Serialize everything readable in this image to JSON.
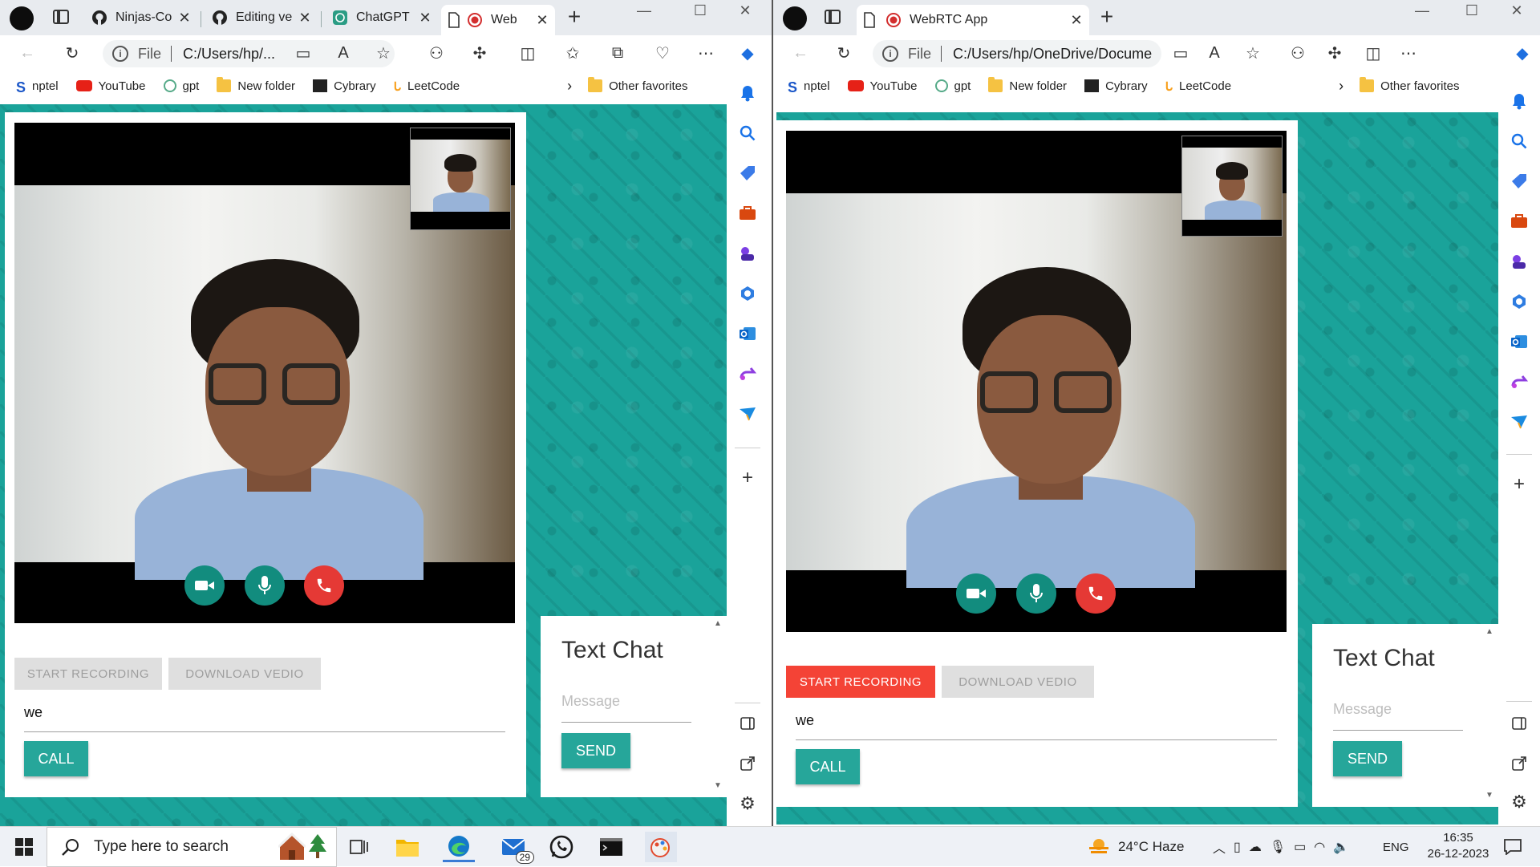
{
  "left_window": {
    "tabs": [
      {
        "label": "Ninjas-Co",
        "icon": "github-icon"
      },
      {
        "label": "Editing ve",
        "icon": "github-icon"
      },
      {
        "label": "ChatGPT",
        "icon": "chatgpt-icon"
      },
      {
        "label": "Web",
        "icon": "record-icon",
        "active": true
      }
    ],
    "address": {
      "prefix": "File",
      "url": "C:/Users/hp/..."
    },
    "favorites": [
      "nptel",
      "YouTube",
      "gpt",
      "New folder",
      "Cybrary",
      "LeetCode"
    ],
    "other_favorites": "Other favorites"
  },
  "right_window": {
    "tabs": [
      {
        "label": "WebRTC App",
        "icon": "record-icon",
        "active": true
      }
    ],
    "address": {
      "prefix": "File",
      "url": "C:/Users/hp/OneDrive/Documents..."
    },
    "favorites": [
      "nptel",
      "YouTube",
      "gpt",
      "New folder",
      "Cybrary",
      "LeetCode"
    ],
    "other_favorites": "Other favorites"
  },
  "app_left": {
    "start_recording": "START RECORDING",
    "download": "DOWNLOAD VEDIO",
    "message_value": "we",
    "call": "CALL",
    "chat_title": "Text Chat",
    "chat_placeholder": "Message",
    "send": "SEND"
  },
  "app_right": {
    "start_recording": "START RECORDING",
    "download": "DOWNLOAD VEDIO",
    "message_value": "we",
    "call": "CALL",
    "chat_title": "Text Chat",
    "chat_placeholder": "Message",
    "send": "SEND"
  },
  "colors": {
    "teal_bg": "#1aa39a",
    "button_teal": "#26a69a",
    "call_green": "#128c7e",
    "hangup_red": "#e53935",
    "recording_red": "#f44336"
  },
  "taskbar": {
    "search_placeholder": "Type here to search",
    "mail_badge": "29",
    "weather": "24°C  Haze",
    "language": "ENG",
    "time": "16:35",
    "date": "26-12-2023"
  }
}
